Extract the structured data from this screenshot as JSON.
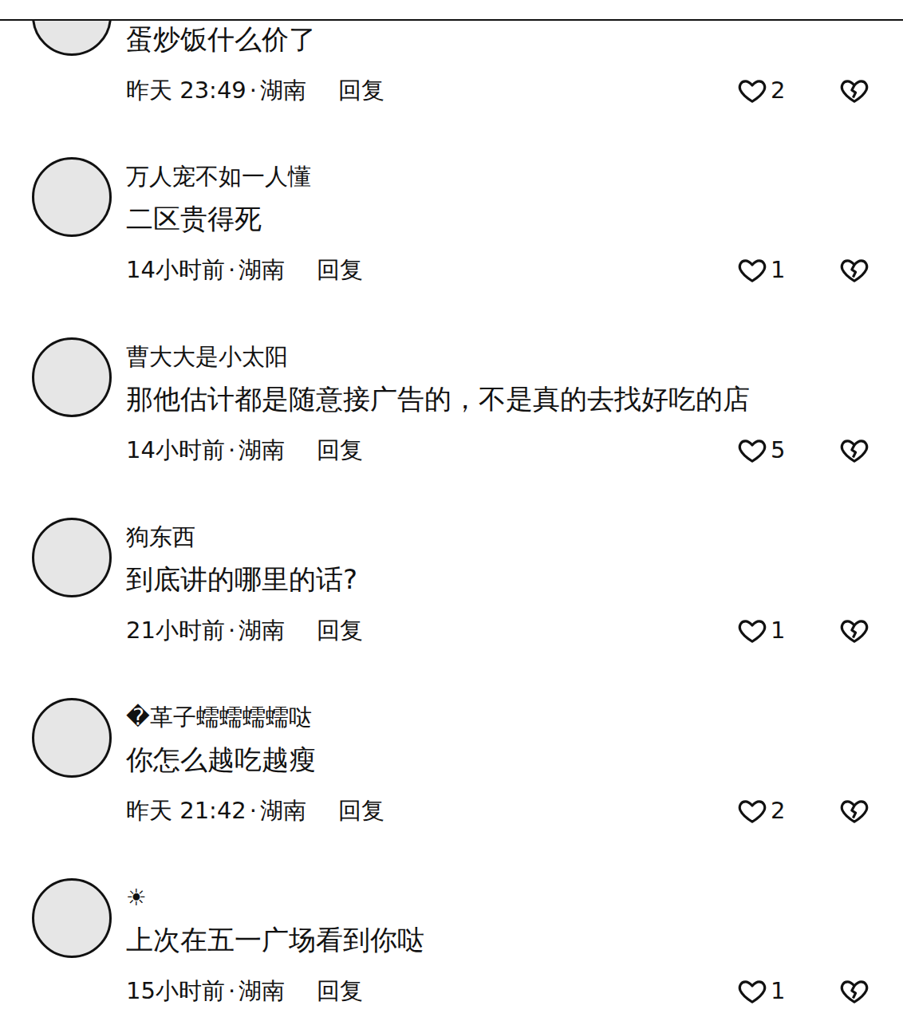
{
  "comments": [
    {
      "name": "",
      "text": "蛋炒饭什么价了",
      "time": "昨天 23:49",
      "separator": "·",
      "location": "湖南",
      "reply": "回复",
      "likes": "2",
      "partial": true
    },
    {
      "name": "万人宠不如一人懂",
      "text": "二区贵得死",
      "time": "14小时前",
      "separator": "·",
      "location": "湖南",
      "reply": "回复",
      "likes": "1",
      "partial": false
    },
    {
      "name": "曹大大是小太阳",
      "text": "那他估计都是随意接广告的，不是真的去找好吃的店",
      "time": "14小时前",
      "separator": "·",
      "location": "湖南",
      "reply": "回复",
      "likes": "5",
      "partial": false
    },
    {
      "name": "狗东西",
      "text": "到底讲的哪里的话?",
      "time": "21小时前",
      "separator": "·",
      "location": "湖南",
      "reply": "回复",
      "likes": "1",
      "partial": false
    },
    {
      "name": "�革子蠕蠕蠕蠕哒",
      "text": "你怎么越吃越瘦",
      "time": "昨天 21:42",
      "separator": "·",
      "location": "湖南",
      "reply": "回复",
      "likes": "2",
      "partial": false
    },
    {
      "name": "☀",
      "text": "上次在五一广场看到你哒",
      "time": "15小时前",
      "separator": "·",
      "location": "湖南",
      "reply": "回复",
      "likes": "1",
      "partial": false
    }
  ]
}
